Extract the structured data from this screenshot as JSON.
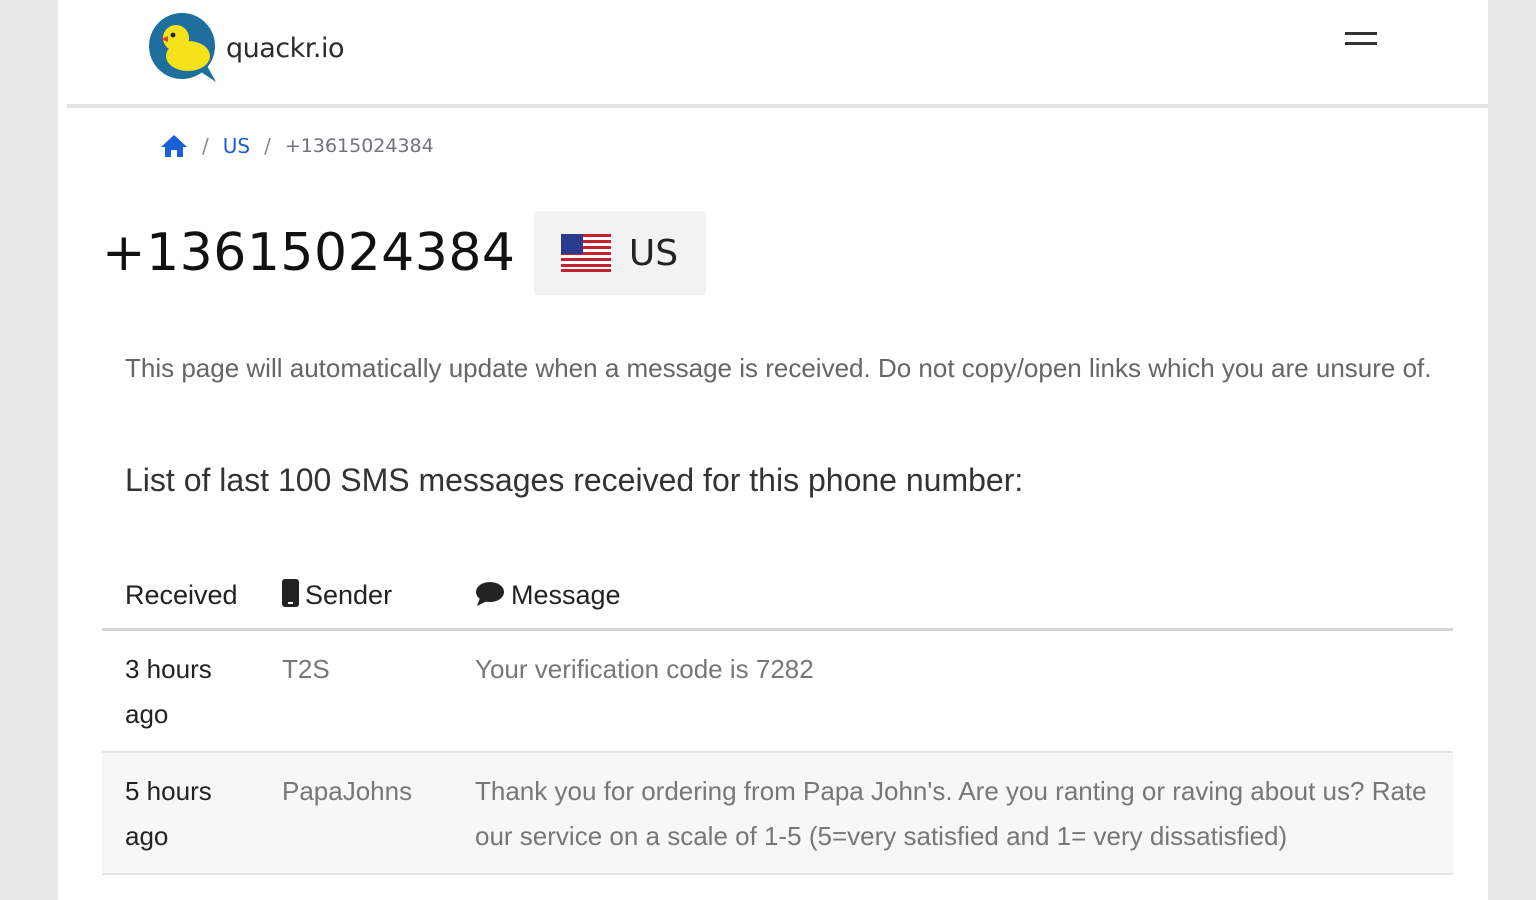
{
  "header": {
    "brand_name": "quackr.io",
    "menu_icon": "hamburger-icon"
  },
  "breadcrumb": {
    "home_icon": "home-icon",
    "separator": "/",
    "country": "US",
    "current": "+13615024384"
  },
  "number": {
    "phone": "+13615024384",
    "country_code": "US",
    "flag_icon": "us-flag-icon"
  },
  "notice": "This page will automatically update when a message is received. Do not copy/open links which you are unsure of.",
  "list_heading": "List of last 100 SMS messages received for this phone number:",
  "table": {
    "headers": {
      "received": "Received",
      "sender": "Sender",
      "message": "Message"
    },
    "rows": [
      {
        "received": "3 hours ago",
        "sender": "T2S",
        "message": "Your verification code is 7282"
      },
      {
        "received": "5 hours ago",
        "sender": "PapaJohns",
        "message": "Thank you for ordering from Papa John's. Are you ranting or raving about us? Rate our service on a scale of 1-5 (5=very satisfied and 1= very dissatisfied)"
      }
    ]
  },
  "colors": {
    "link": "#1a5fd6",
    "logo_bubble": "#1f6f9e",
    "duck": "#f6e21b"
  }
}
